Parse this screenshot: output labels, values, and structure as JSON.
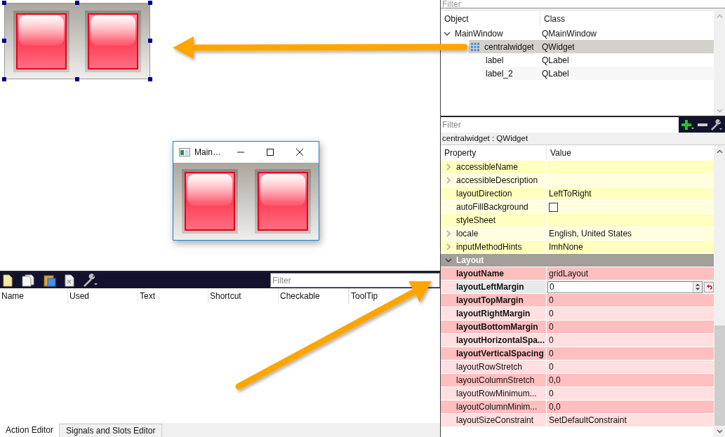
{
  "preview_window": {
    "title": "Main…"
  },
  "object_inspector": {
    "filter": {
      "placeholder": "Filter"
    },
    "columns": [
      "Object",
      "Class"
    ],
    "tree": [
      {
        "name": "MainWindow",
        "class": "QMainWindow",
        "kind": "object",
        "expanded": true,
        "selected": false,
        "children": [
          {
            "name": "centralwidget",
            "class": "QWidget",
            "kind": "layout-widget",
            "selected": true,
            "children": [
              {
                "name": "label",
                "class": "QLabel",
                "kind": "object",
                "selected": false
              },
              {
                "name": "label_2",
                "class": "QLabel",
                "kind": "object",
                "selected": false
              }
            ]
          }
        ]
      }
    ]
  },
  "property_editor": {
    "filter": {
      "placeholder": "Filter"
    },
    "object_caption": "centralwidget : QWidget",
    "columns": [
      "Property",
      "Value"
    ],
    "sections": [
      {
        "color": "#ffffbf",
        "rows": [
          {
            "name": "accessibleName",
            "kind": "text",
            "expandable": true,
            "modified": false,
            "selected": false
          },
          {
            "name": "accessibleDescription",
            "kind": "text",
            "expandable": true,
            "modified": false,
            "selected": false
          },
          {
            "name": "layoutDirection",
            "value": "LeftToRight",
            "kind": "text",
            "expandable": false,
            "modified": false,
            "selected": false
          },
          {
            "name": "autoFillBackground",
            "kind": "checkbox",
            "checked": false,
            "expandable": false,
            "modified": false,
            "selected": false
          },
          {
            "name": "styleSheet",
            "kind": "text",
            "expandable": false,
            "modified": false,
            "selected": false
          },
          {
            "name": "locale",
            "value": "English, United States",
            "kind": "text",
            "expandable": true,
            "modified": false,
            "selected": false
          },
          {
            "name": "inputMethodHints",
            "value": "ImhNone",
            "kind": "text",
            "expandable": true,
            "modified": false,
            "selected": false
          }
        ]
      },
      {
        "title": "Layout",
        "expanded": true,
        "color": "#ffbfbf",
        "rows": [
          {
            "name": "layoutName",
            "value": "gridLayout",
            "kind": "text",
            "expandable": false,
            "modified": true,
            "selected": false
          },
          {
            "name": "layoutLeftMargin",
            "value": "0",
            "kind": "spinbox",
            "expandable": false,
            "modified": true,
            "selected": true
          },
          {
            "name": "layoutTopMargin",
            "value": "0",
            "kind": "text",
            "expandable": false,
            "modified": true,
            "selected": false
          },
          {
            "name": "layoutRightMargin",
            "value": "0",
            "kind": "text",
            "expandable": false,
            "modified": true,
            "selected": false
          },
          {
            "name": "layoutBottomMargin",
            "value": "0",
            "kind": "text",
            "expandable": false,
            "modified": true,
            "selected": false
          },
          {
            "name": "layoutHorizontalSpa...",
            "value": "0",
            "kind": "text",
            "expandable": false,
            "modified": true,
            "selected": false
          },
          {
            "name": "layoutVerticalSpacing",
            "value": "0",
            "kind": "text",
            "expandable": false,
            "modified": true,
            "selected": false
          },
          {
            "name": "layoutRowStretch",
            "value": "0",
            "kind": "text",
            "expandable": false,
            "modified": false,
            "selected": false
          },
          {
            "name": "layoutColumnStretch",
            "value": "0,0",
            "kind": "text",
            "expandable": false,
            "modified": false,
            "selected": false
          },
          {
            "name": "layoutRowMinimum...",
            "value": "0",
            "kind": "text",
            "expandable": false,
            "modified": false,
            "selected": false
          },
          {
            "name": "layoutColumnMinim...",
            "value": "0,0",
            "kind": "text",
            "expandable": false,
            "modified": false,
            "selected": false
          },
          {
            "name": "layoutSizeConstraint",
            "value": "SetDefaultConstraint",
            "kind": "text",
            "expandable": false,
            "modified": false,
            "selected": false
          }
        ]
      }
    ]
  },
  "action_editor": {
    "filter": {
      "placeholder": "Filter"
    },
    "columns": [
      "Name",
      "Used",
      "Text",
      "Shortcut",
      "Checkable",
      "ToolTip"
    ]
  },
  "bottom_tabs": [
    {
      "label": "Action Editor",
      "selected": true
    },
    {
      "label": "Signals and Slots Editor",
      "selected": false
    }
  ]
}
